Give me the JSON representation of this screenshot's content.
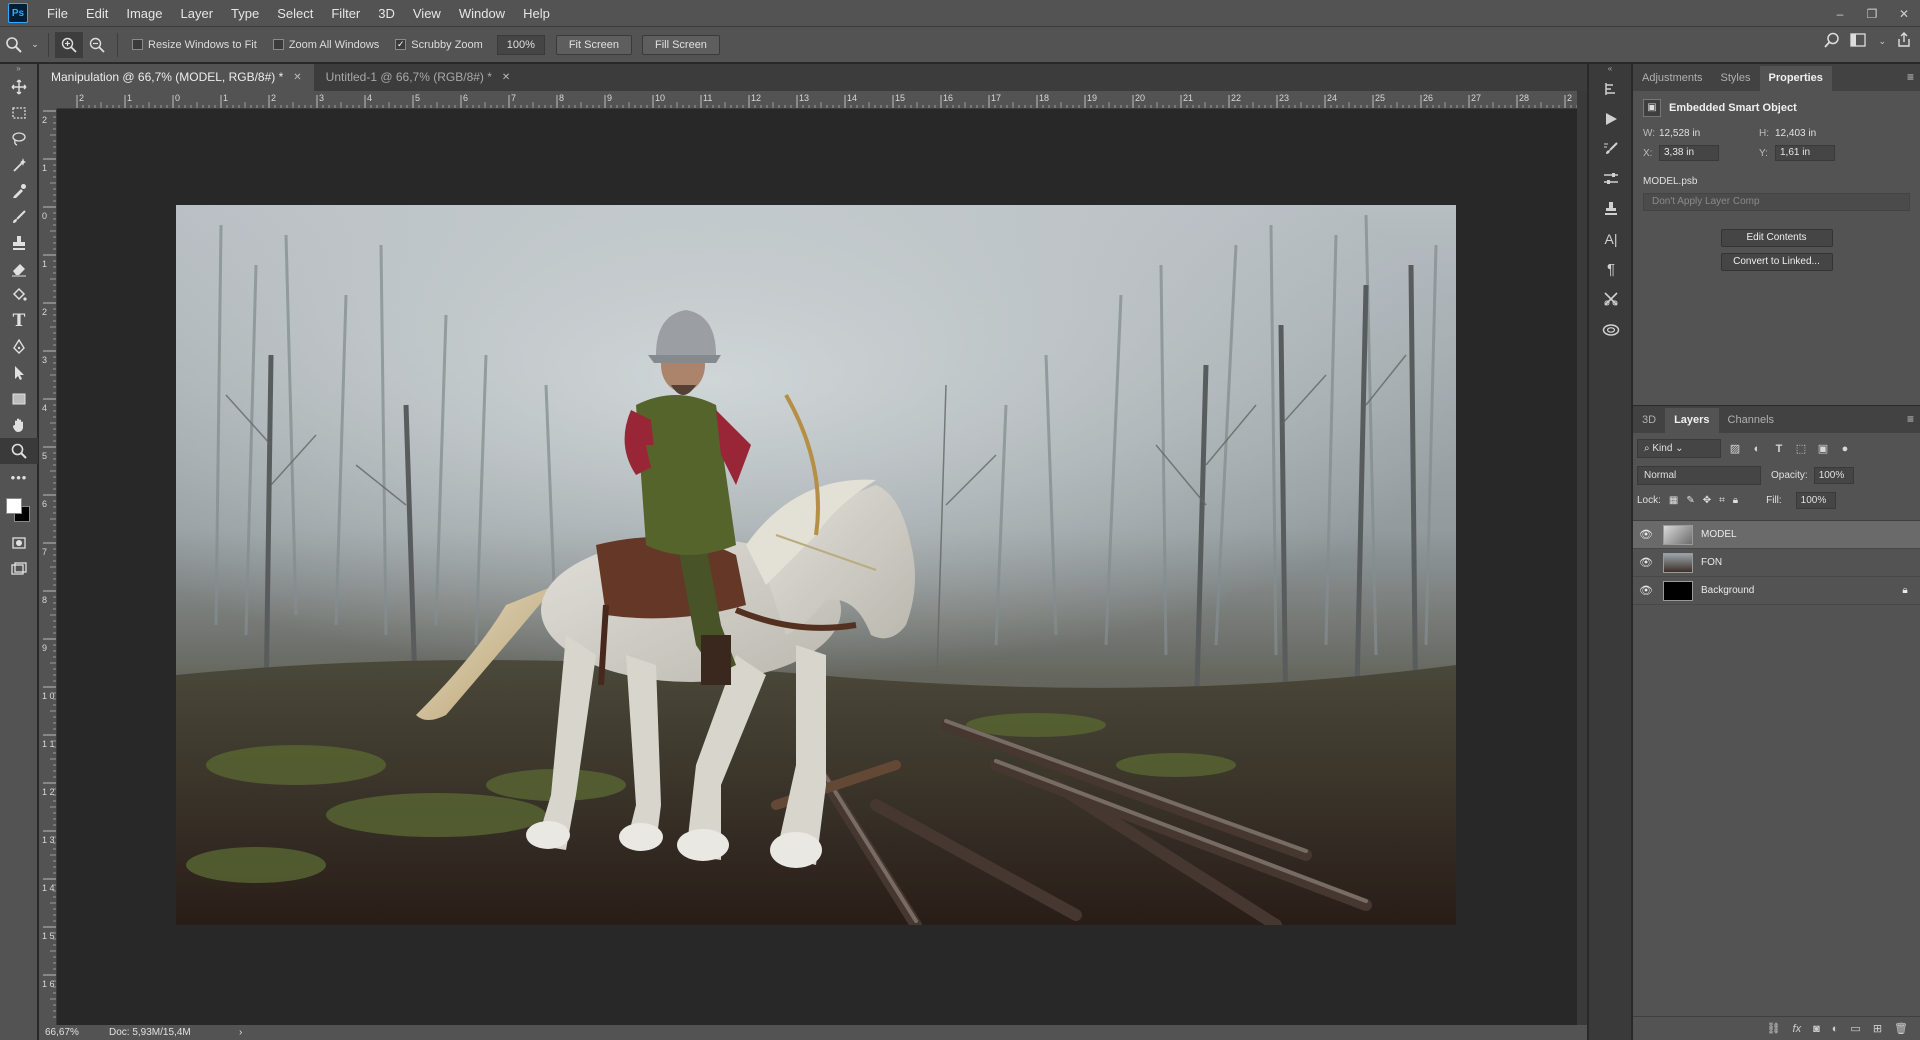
{
  "app": {
    "logo": "Ps"
  },
  "menu": [
    "File",
    "Edit",
    "Image",
    "Layer",
    "Type",
    "Select",
    "Filter",
    "3D",
    "View",
    "Window",
    "Help"
  ],
  "window_controls": {
    "minimize": "–",
    "restore": "❐",
    "close": "✕"
  },
  "options": {
    "resize_windows_label": "Resize Windows to Fit",
    "resize_windows_checked": false,
    "zoom_all_label": "Zoom All Windows",
    "zoom_all_checked": false,
    "scrubby_label": "Scrubby Zoom",
    "scrubby_checked": true,
    "zoom_value": "100%",
    "fit_screen": "Fit Screen",
    "fill_screen": "Fill Screen"
  },
  "tabs": [
    {
      "label": "Manipulation  @ 66,7% (MODEL, RGB/8#) *",
      "active": true
    },
    {
      "label": "Untitled-1 @ 66,7% (RGB/8#) *",
      "active": false
    }
  ],
  "ruler": {
    "top": [
      "2",
      "1",
      "0",
      "1",
      "2",
      "3",
      "4",
      "5",
      "6",
      "7",
      "8",
      "9",
      "10",
      "11",
      "12",
      "13",
      "14",
      "15",
      "16",
      "17",
      "18",
      "19",
      "20",
      "21",
      "22",
      "23",
      "24",
      "25",
      "26",
      "27",
      "28",
      "2"
    ],
    "left": [
      "2",
      "1",
      "0",
      "1",
      "2",
      "3",
      "4",
      "5",
      "6",
      "7",
      "8",
      "9",
      "1 0",
      "1 1",
      "1 2",
      "1 3",
      "1 4",
      "1 5",
      "1 6"
    ]
  },
  "status": {
    "zoom": "66,67%",
    "doc": "Doc: 5,93M/15,4M",
    "arrow": "›"
  },
  "colors": {
    "foreground": "#ffffff",
    "background": "#000000",
    "accent": "#31a8ff"
  },
  "properties_panel": {
    "tabs": [
      "Adjustments",
      "Styles",
      "Properties"
    ],
    "active_tab": "Properties",
    "type_label": "Embedded Smart Object",
    "w_label": "W:",
    "w_value": "12,528 in",
    "h_label": "H:",
    "h_value": "12,403 in",
    "x_label": "X:",
    "x_value": "3,38 in",
    "y_label": "Y:",
    "y_value": "1,61 in",
    "filename": "MODEL.psb",
    "layer_comp_placeholder": "Don't Apply Layer Comp",
    "edit_contents": "Edit Contents",
    "convert_linked": "Convert to Linked..."
  },
  "layers_panel": {
    "tabs": [
      "3D",
      "Layers",
      "Channels"
    ],
    "active_tab": "Layers",
    "kind_label": "Kind",
    "blend_mode": "Normal",
    "opacity_label": "Opacity:",
    "opacity_value": "100%",
    "lock_label": "Lock:",
    "fill_label": "Fill:",
    "fill_value": "100%",
    "layers": [
      {
        "name": "MODEL",
        "selected": true,
        "visible": true,
        "locked": false
      },
      {
        "name": "FON",
        "selected": false,
        "visible": true,
        "locked": false
      },
      {
        "name": "Background",
        "selected": false,
        "visible": true,
        "locked": true
      }
    ]
  }
}
